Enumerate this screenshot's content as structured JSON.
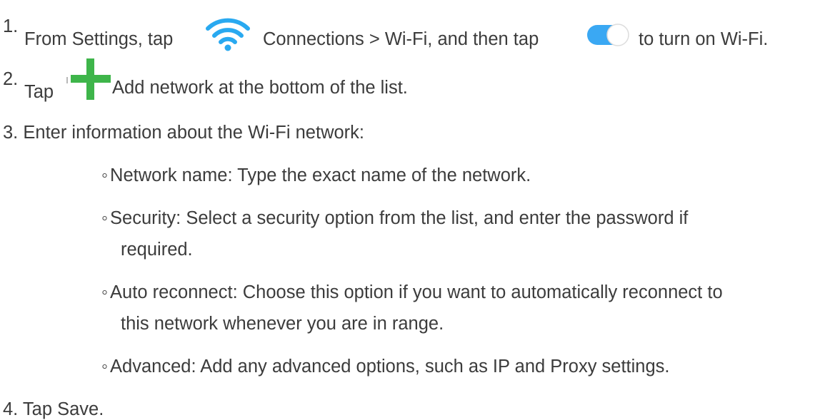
{
  "steps": [
    {
      "number": "1.",
      "text_before_icon": "From Settings, tap",
      "icon": "wifi-icon",
      "text_middle": "Connections > Wi-Fi, and then tap",
      "icon2": "toggle-switch-icon",
      "text_after": "to turn on Wi-Fi."
    },
    {
      "number": "2.",
      "text_before_icon": "Tap",
      "icon": "plus-icon",
      "text_after": "Add network at the bottom of the list."
    },
    {
      "number": "3.",
      "text": "Enter information about the Wi-Fi network:",
      "subitems": [
        {
          "bullet": "◦",
          "lines": [
            "Network name: Type the exact name of the network."
          ]
        },
        {
          "bullet": "◦",
          "lines": [
            "Security: Select a security option from the list, and enter the password if",
            "required."
          ]
        },
        {
          "bullet": "◦",
          "lines": [
            "Auto reconnect: Choose this option if you want to automatically reconnect to",
            "this network whenever you are in range."
          ]
        },
        {
          "bullet": "◦",
          "lines": [
            "Advanced: Add any advanced options, such as IP and Proxy settings."
          ]
        }
      ]
    },
    {
      "number": "4.",
      "text": "Tap Save."
    }
  ],
  "colors": {
    "text": "#3c3c3c",
    "wifi_blue": "#29a9f0",
    "toggle_blue": "#3aa8f3",
    "plus_green": "#3eb54a"
  }
}
